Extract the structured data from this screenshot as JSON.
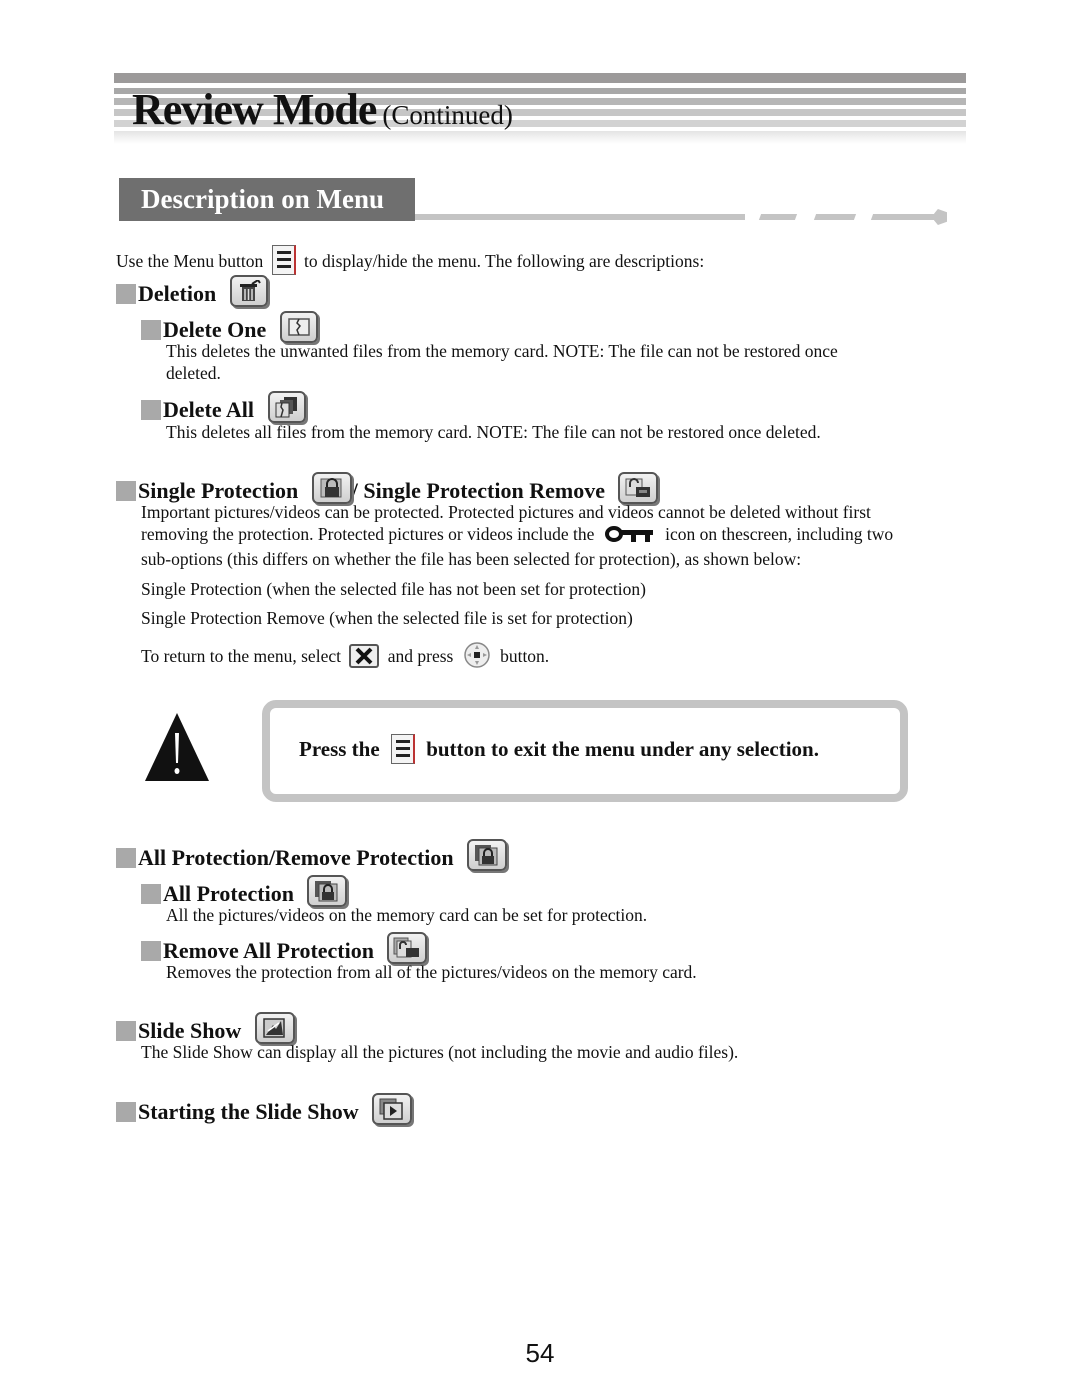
{
  "header": {
    "title": "Review Mode",
    "subtitle": "(Continued)"
  },
  "section": {
    "title": "Description on Menu"
  },
  "intro": {
    "before_icon": "Use the Menu button",
    "after_icon": "to display/hide the menu. The following are descriptions:",
    "icon": "menu-button-icon"
  },
  "deletion": {
    "heading": "Deletion",
    "icon": "trash-icon",
    "delete_one": {
      "heading": "Delete One",
      "icon": "delete-one-icon",
      "text_line1": "This deletes the unwanted files from the memory card. NOTE: The file can not be restored once",
      "text_line2": "deleted."
    },
    "delete_all": {
      "heading": "Delete All",
      "icon": "delete-all-icon",
      "text": "This deletes all files from the memory card. NOTE: The file can not be restored once deleted."
    }
  },
  "single_protection": {
    "heading1": "Single Protection",
    "separator": "/",
    "heading2": "Single Protection Remove",
    "icon1": "lock-icon",
    "icon2": "unlock-icon",
    "line1": "Important pictures/videos can be protected. Protected pictures and videos cannot be deleted without first",
    "line2_before": "removing the protection. Protected pictures or videos include the",
    "line2_after": "icon on thescreen, including two",
    "line3": "sub-options (this differs on whether the file has been selected for protection), as shown below:",
    "key_icon": "key-icon",
    "option1": "Single Protection (when the selected file has not been set for protection)",
    "option2": "Single Protection Remove (when the selected file is set for protection)",
    "return_before": "To return to the menu, select",
    "return_middle": "and press",
    "return_after": "button.",
    "close_icon": "close-x-icon",
    "dpad_icon": "dpad-icon"
  },
  "warning": {
    "before": "Press the",
    "after": "button to exit the menu under any selection.",
    "icon": "warning-icon"
  },
  "all_protection": {
    "heading": "All Protection/Remove Protection",
    "icon": "all-lock-icon",
    "all_protection": {
      "heading": "All Protection",
      "text": "All the pictures/videos on the memory card can be set for protection."
    },
    "remove_all": {
      "heading": "Remove All Protection",
      "text": "Removes the protection from all of the pictures/videos on the memory card."
    }
  },
  "slide_show": {
    "heading": "Slide Show",
    "icon": "slideshow-icon",
    "text": "The Slide Show can display all the pictures (not including the movie and audio files)."
  },
  "starting_slide_show": {
    "heading": "Starting the Slide Show",
    "icon": "play-icon"
  },
  "page_number": "54"
}
